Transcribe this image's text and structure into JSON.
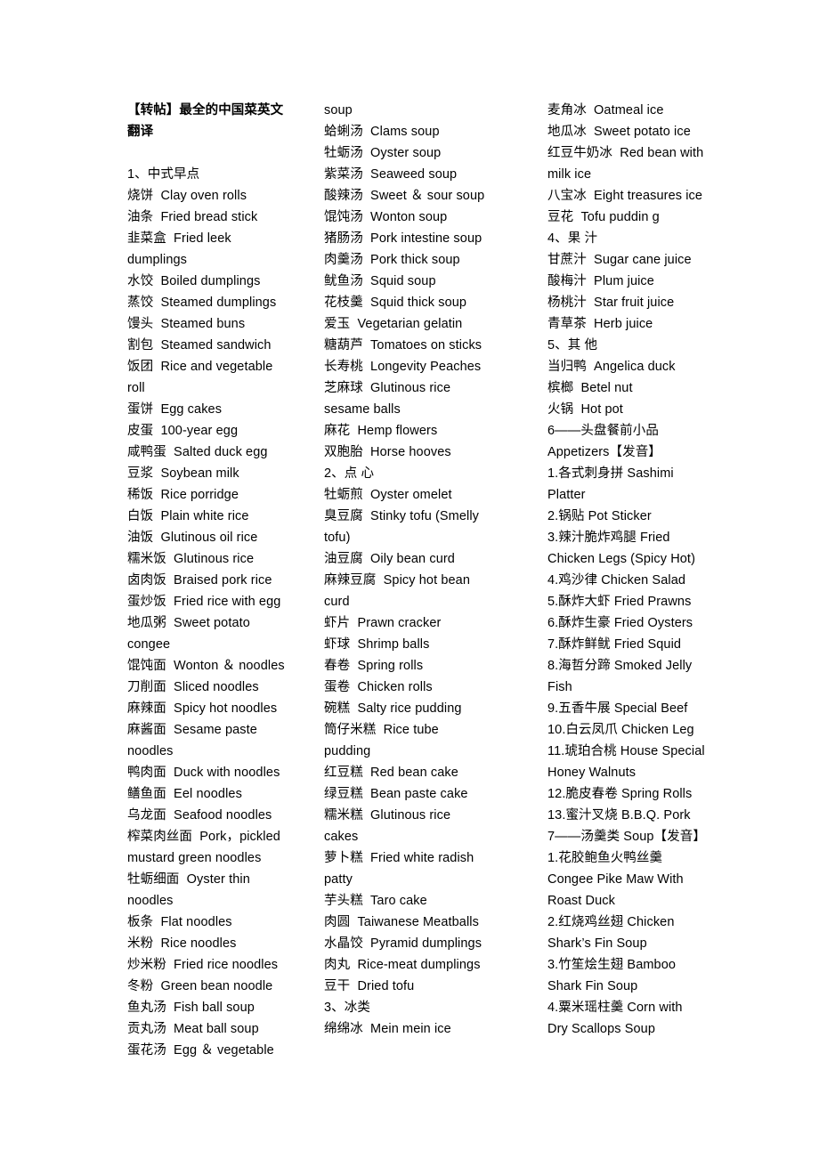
{
  "document": {
    "title": "【转帖】最全的中国菜英文翻译",
    "background_color": "#ffffff",
    "text_color": "#000000",
    "column_count": 3
  },
  "columns": [
    {
      "name": "column-1",
      "lines": [
        {
          "text": "【转帖】最全的中国菜英文",
          "bold": true
        },
        {
          "text": "翻译",
          "bold": true
        },
        {
          "text": "",
          "blank": true
        },
        {
          "text": "1、中式早点"
        },
        {
          "text": "烧饼  Clay oven rolls"
        },
        {
          "text": "油条  Fried bread stick"
        },
        {
          "text": "韭菜盒  Fried leek"
        },
        {
          "text": "dumplings"
        },
        {
          "text": "水饺  Boiled dumplings"
        },
        {
          "text": "蒸饺  Steamed dumplings"
        },
        {
          "text": "馒头  Steamed buns"
        },
        {
          "text": "割包  Steamed sandwich"
        },
        {
          "text": "饭团  Rice and vegetable"
        },
        {
          "text": "roll"
        },
        {
          "text": "蛋饼  Egg cakes"
        },
        {
          "text": "皮蛋  100-year egg"
        },
        {
          "text": "咸鸭蛋  Salted duck egg"
        },
        {
          "text": "豆浆  Soybean milk"
        },
        {
          "text": "稀饭  Rice porridge"
        },
        {
          "text": "白饭  Plain white rice"
        },
        {
          "text": "油饭  Glutinous oil rice"
        },
        {
          "text": "糯米饭  Glutinous rice"
        },
        {
          "text": "卤肉饭  Braised pork rice"
        },
        {
          "text": "蛋炒饭  Fried rice with egg"
        },
        {
          "text": "地瓜粥  Sweet potato"
        },
        {
          "text": "congee"
        },
        {
          "text": "馄饨面  Wonton ＆ noodles"
        },
        {
          "text": "刀削面  Sliced noodles"
        },
        {
          "text": "麻辣面  Spicy hot noodles"
        },
        {
          "text": "麻酱面  Sesame paste"
        },
        {
          "text": "noodles"
        },
        {
          "text": "鸭肉面  Duck with noodles"
        },
        {
          "text": "鳝鱼面  Eel noodles"
        },
        {
          "text": "乌龙面  Seafood noodles"
        },
        {
          "text": "榨菜肉丝面  Pork，pickled"
        },
        {
          "text": "mustard green noodles"
        },
        {
          "text": "牡蛎细面  Oyster thin"
        },
        {
          "text": "noodles"
        },
        {
          "text": "板条  Flat noodles"
        },
        {
          "text": "米粉  Rice noodles"
        },
        {
          "text": "炒米粉  Fried rice noodles"
        },
        {
          "text": "冬粉  Green bean noodle"
        },
        {
          "text": "鱼丸汤  Fish ball soup"
        },
        {
          "text": "贡丸汤  Meat ball soup"
        },
        {
          "text": "蛋花汤  Egg ＆ vegetable"
        }
      ]
    },
    {
      "name": "column-2",
      "lines": [
        {
          "text": "soup"
        },
        {
          "text": "蛤蜊汤  Clams soup"
        },
        {
          "text": "牡蛎汤  Oyster soup"
        },
        {
          "text": "紫菜汤  Seaweed soup"
        },
        {
          "text": "酸辣汤  Sweet ＆ sour soup"
        },
        {
          "text": "馄饨汤  Wonton soup"
        },
        {
          "text": "猪肠汤  Pork intestine soup"
        },
        {
          "text": "肉羹汤  Pork thick soup"
        },
        {
          "text": "鱿鱼汤  Squid soup"
        },
        {
          "text": "花枝羹  Squid thick soup"
        },
        {
          "text": "爱玉  Vegetarian gelatin"
        },
        {
          "text": "糖葫芦  Tomatoes on sticks"
        },
        {
          "text": "长寿桃  Longevity Peaches"
        },
        {
          "text": "芝麻球  Glutinous rice"
        },
        {
          "text": "sesame balls"
        },
        {
          "text": "麻花  Hemp flowers"
        },
        {
          "text": "双胞胎  Horse hooves"
        },
        {
          "text": "2、点 心"
        },
        {
          "text": "牡蛎煎  Oyster omelet"
        },
        {
          "text": "臭豆腐  Stinky tofu (Smelly"
        },
        {
          "text": "tofu)"
        },
        {
          "text": "油豆腐  Oily bean curd"
        },
        {
          "text": "麻辣豆腐  Spicy hot bean"
        },
        {
          "text": "curd"
        },
        {
          "text": "虾片  Prawn cracker"
        },
        {
          "text": "虾球  Shrimp balls"
        },
        {
          "text": "春卷  Spring rolls"
        },
        {
          "text": "蛋卷  Chicken rolls"
        },
        {
          "text": "碗糕  Salty rice pudding"
        },
        {
          "text": "筒仔米糕  Rice tube"
        },
        {
          "text": "pudding"
        },
        {
          "text": "红豆糕  Red bean cake"
        },
        {
          "text": "绿豆糕  Bean paste cake"
        },
        {
          "text": "糯米糕  Glutinous rice"
        },
        {
          "text": "cakes"
        },
        {
          "text": "萝卜糕  Fried white radish"
        },
        {
          "text": "patty"
        },
        {
          "text": "芋头糕  Taro cake"
        },
        {
          "text": "肉圆  Taiwanese Meatballs"
        },
        {
          "text": "水晶饺  Pyramid dumplings"
        },
        {
          "text": "肉丸  Rice-meat dumplings"
        },
        {
          "text": "豆干  Dried tofu"
        },
        {
          "text": "3、冰类"
        },
        {
          "text": "绵绵冰  Mein mein ice"
        }
      ]
    },
    {
      "name": "column-3",
      "lines": [
        {
          "text": "麦角冰  Oatmeal ice"
        },
        {
          "text": "地瓜冰  Sweet potato ice"
        },
        {
          "text": "红豆牛奶冰  Red bean with"
        },
        {
          "text": "milk ice"
        },
        {
          "text": "八宝冰  Eight treasures ice"
        },
        {
          "text": "豆花  Tofu puddin g"
        },
        {
          "text": "4、果 汁"
        },
        {
          "text": "甘蔗汁  Sugar cane juice"
        },
        {
          "text": "酸梅汁  Plum juice"
        },
        {
          "text": "杨桃汁  Star fruit juice"
        },
        {
          "text": "青草茶  Herb juice"
        },
        {
          "text": "5、其 他"
        },
        {
          "text": "当归鸭  Angelica duck"
        },
        {
          "text": "槟榔  Betel nut"
        },
        {
          "text": "火锅  Hot pot"
        },
        {
          "text": "6——头盘餐前小品"
        },
        {
          "text": "Appetizers【发音】"
        },
        {
          "text": "1.各式刺身拼 Sashimi"
        },
        {
          "text": "Platter"
        },
        {
          "text": "2.锅贴 Pot Sticker"
        },
        {
          "text": "3.辣汁脆炸鸡腿 Fried"
        },
        {
          "text": "Chicken Legs (Spicy Hot)"
        },
        {
          "text": "4.鸡沙律 Chicken Salad"
        },
        {
          "text": "5.酥炸大虾 Fried Prawns"
        },
        {
          "text": "6.酥炸生豪 Fried Oysters"
        },
        {
          "text": "7.酥炸鲜鱿 Fried Squid"
        },
        {
          "text": "8.海哲分蹄 Smoked Jelly"
        },
        {
          "text": "Fish"
        },
        {
          "text": "9.五香牛展 Special Beef"
        },
        {
          "text": "10.白云凤爪 Chicken Leg"
        },
        {
          "text": "11.琥珀合桃 House Special"
        },
        {
          "text": "Honey Walnuts"
        },
        {
          "text": "12.脆皮春卷 Spring Rolls"
        },
        {
          "text": "13.蜜汁叉烧 B.B.Q. Pork"
        },
        {
          "text": "7——汤羹类 Soup【发音】"
        },
        {
          "text": "1.花胶鲍鱼火鸭丝羹"
        },
        {
          "text": "Congee Pike Maw With"
        },
        {
          "text": "Roast Duck"
        },
        {
          "text": "2.红烧鸡丝翅 Chicken"
        },
        {
          "text": "Shark’s Fin Soup"
        },
        {
          "text": "3.竹笙烩生翅 Bamboo"
        },
        {
          "text": "Shark Fin Soup"
        },
        {
          "text": "4.粟米瑶柱羹 Corn with"
        },
        {
          "text": "Dry Scallops Soup"
        }
      ]
    }
  ]
}
